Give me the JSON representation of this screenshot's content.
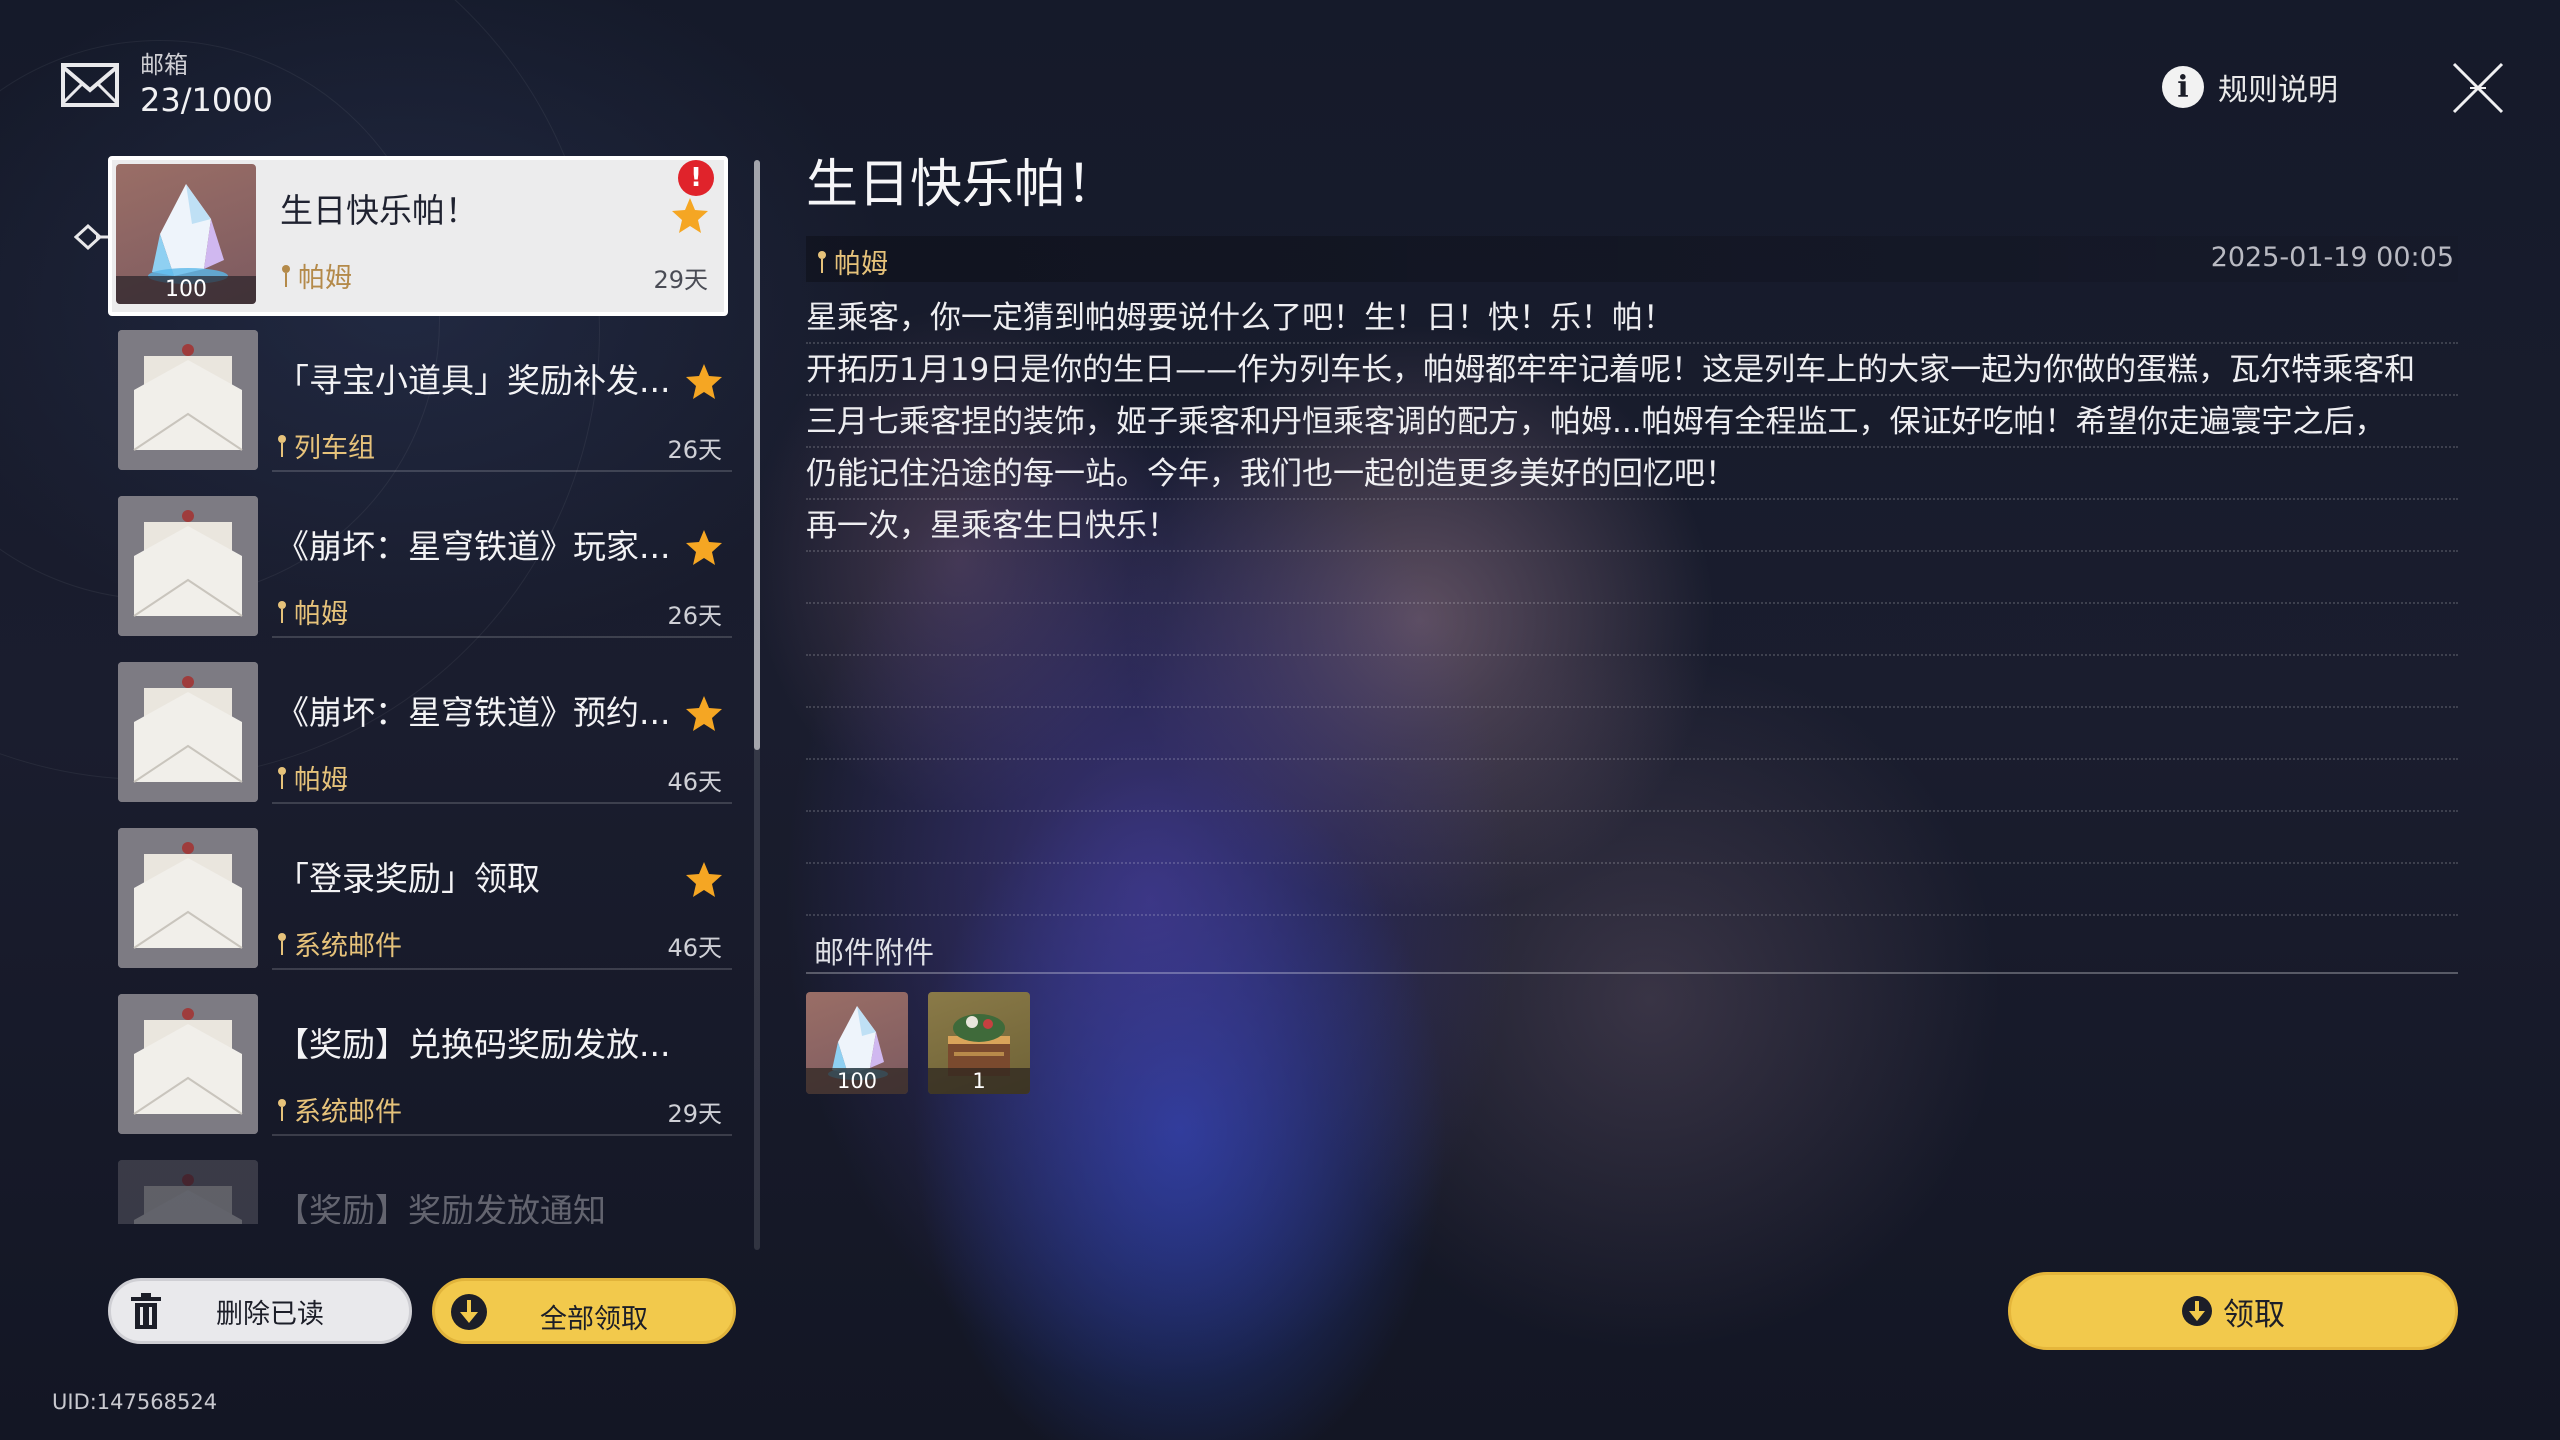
{
  "header": {
    "mailbox_label": "邮箱",
    "mailbox_count": "23/1000",
    "rules_label": "规则说明",
    "rules_icon": "info-icon",
    "close_icon": "close-icon"
  },
  "mail_list": [
    {
      "title": "生日快乐帕！",
      "sender": "帕姆",
      "days": "29天",
      "starred": true,
      "alert": "!",
      "thumb": "crystal",
      "thumb_count": "100",
      "active": true
    },
    {
      "title": "「寻宝小道具」奖励补发...",
      "sender": "列车组",
      "days": "26天",
      "starred": true,
      "thumb": "envelope"
    },
    {
      "title": "《崩坏：星穹铁道》玩家...",
      "sender": "帕姆",
      "days": "26天",
      "starred": true,
      "thumb": "envelope"
    },
    {
      "title": "《崩坏：星穹铁道》预约...",
      "sender": "帕姆",
      "days": "46天",
      "starred": true,
      "thumb": "envelope"
    },
    {
      "title": "「登录奖励」领取",
      "sender": "系统邮件",
      "days": "46天",
      "starred": true,
      "thumb": "envelope"
    },
    {
      "title": "【奖励】兑换码奖励发放...",
      "sender": "系统邮件",
      "days": "29天",
      "starred": false,
      "thumb": "envelope"
    },
    {
      "title": "【奖励】奖励发放通知",
      "sender": "",
      "days": "",
      "starred": false,
      "thumb": "envelope"
    }
  ],
  "footer": {
    "delete_read_label": "删除已读",
    "claim_all_label": "全部领取",
    "uid": "UID:147568524"
  },
  "detail": {
    "title": "生日快乐帕！",
    "sender": "帕姆",
    "date": "2025-01-19 00:05",
    "body_lines": [
      "星乘客，你一定猜到帕姆要说什么了吧！生！日！快！乐！帕！",
      "开拓历1月19日是你的生日——作为列车长，帕姆都牢牢记着呢！这是列车上的大家一起为你做的蛋糕，瓦尔特乘客和",
      "三月七乘客捏的装饰，姬子乘客和丹恒乘客调的配方，帕姆...帕姆有全程监工，保证好吃帕！希望你走遍寰宇之后，",
      "仍能记住沿途的每一站。今年，我们也一起创造更多美好的回忆吧！",
      "再一次，星乘客生日快乐！",
      "",
      "",
      "",
      "",
      "",
      "",
      "",
      ""
    ],
    "attachments_label": "邮件附件",
    "attachments": [
      {
        "icon": "crystal-icon",
        "count": "100"
      },
      {
        "icon": "cake-item-icon",
        "count": "1"
      }
    ],
    "claim_label": "领取"
  },
  "colors": {
    "accent_yellow": "#f2c94c",
    "sender_gold": "#e6c27a",
    "alert_red": "#e0232b",
    "star_orange": "#f5a623"
  }
}
